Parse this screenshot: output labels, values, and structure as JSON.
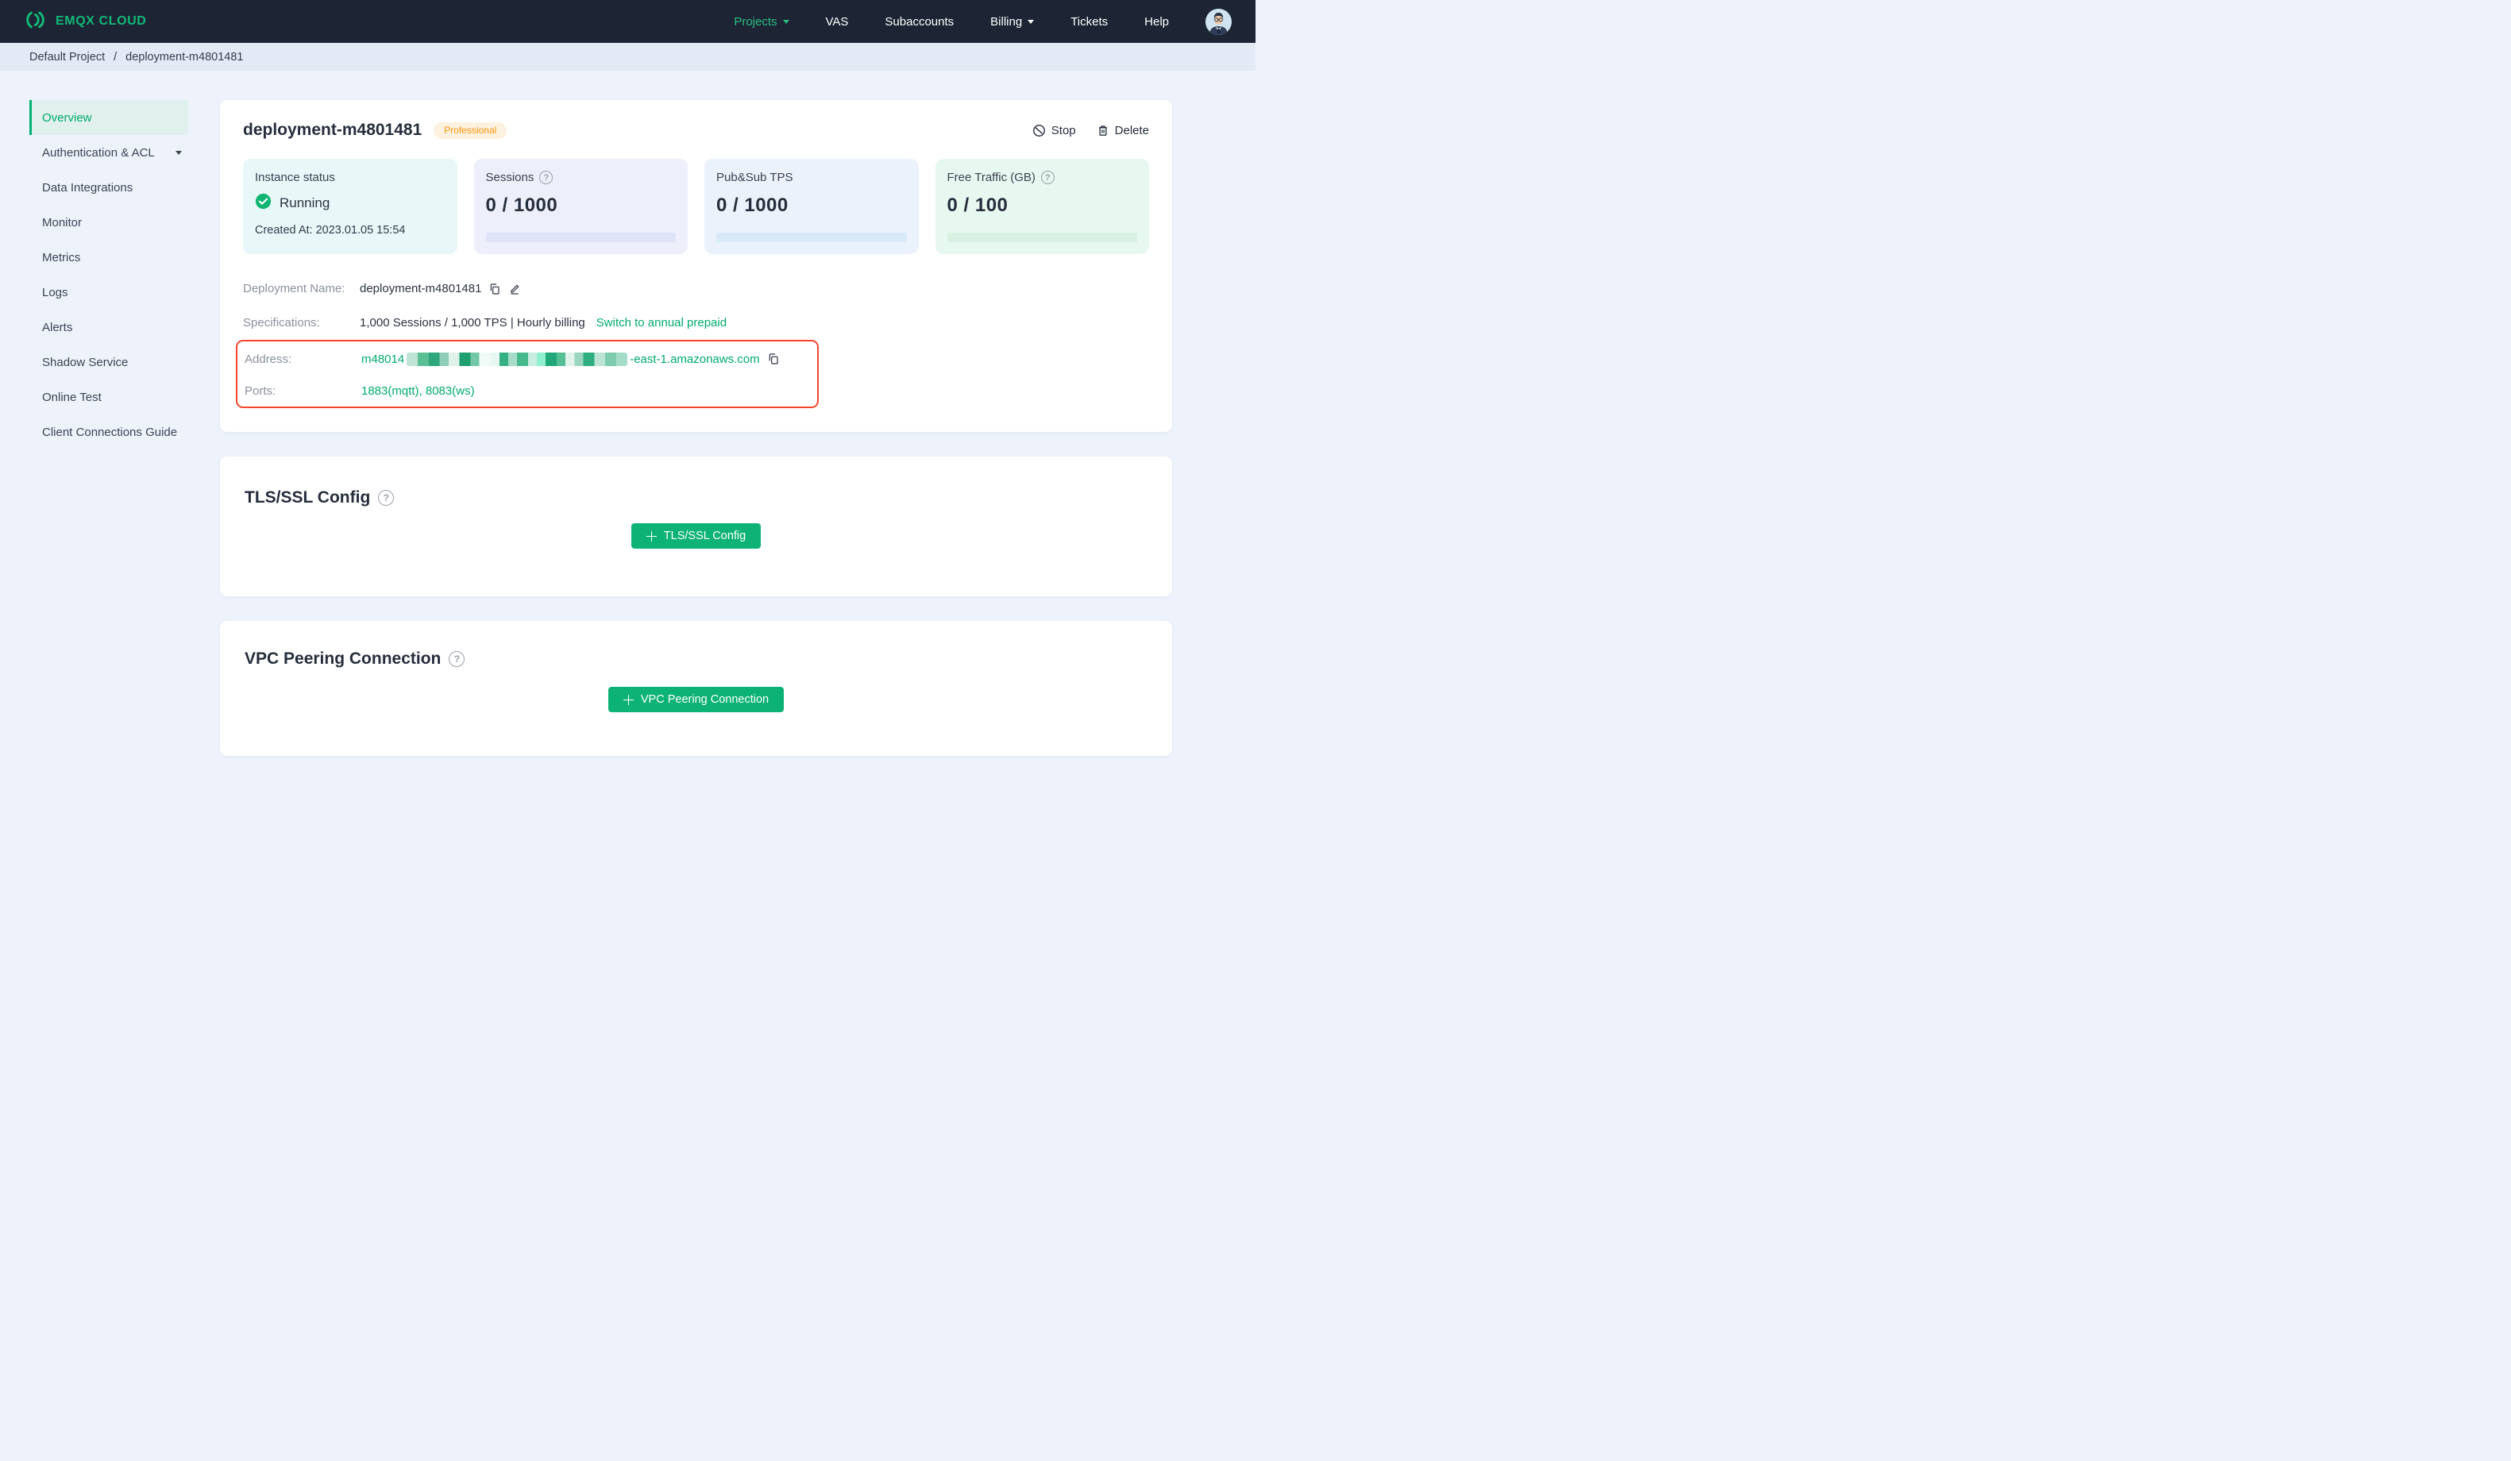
{
  "nav": {
    "brand": "EMQX CLOUD",
    "projects": "Projects",
    "vas": "VAS",
    "subaccounts": "Subaccounts",
    "billing": "Billing",
    "tickets": "Tickets",
    "help": "Help"
  },
  "breadcrumb": {
    "project": "Default Project",
    "separator": "/",
    "current": "deployment-m4801481"
  },
  "sidebar": {
    "items": [
      {
        "label": "Overview"
      },
      {
        "label": "Authentication & ACL"
      },
      {
        "label": "Data Integrations"
      },
      {
        "label": "Monitor"
      },
      {
        "label": "Metrics"
      },
      {
        "label": "Logs"
      },
      {
        "label": "Alerts"
      },
      {
        "label": "Shadow Service"
      },
      {
        "label": "Online Test"
      },
      {
        "label": "Client Connections Guide"
      }
    ]
  },
  "deployment": {
    "title": "deployment-m4801481",
    "badge": "Professional",
    "stop_label": "Stop",
    "delete_label": "Delete",
    "stats": {
      "instance": {
        "label": "Instance status",
        "status": "Running",
        "created": "Created At: 2023.01.05 15:54"
      },
      "sessions": {
        "label": "Sessions",
        "value": "0 / 1000",
        "help": "?"
      },
      "tps": {
        "label": "Pub&Sub TPS",
        "value": "0 / 1000"
      },
      "traffic": {
        "label": "Free Traffic (GB)",
        "value": "0 / 100",
        "help": "?"
      }
    },
    "details": {
      "name_label": "Deployment Name:",
      "name_value": "deployment-m4801481",
      "spec_label": "Specifications:",
      "spec_value": "1,000 Sessions / 1,000 TPS | Hourly billing",
      "spec_link": "Switch to annual prepaid",
      "address_label": "Address:",
      "address_prefix": "m48014",
      "address_suffix": "-east-1.amazonaws.com",
      "ports_label": "Ports:",
      "ports_value": "1883(mqtt), 8083(ws)"
    }
  },
  "tls": {
    "title": "TLS/SSL Config",
    "help": "?",
    "button": "TLS/SSL Config"
  },
  "vpc": {
    "title": "VPC Peering Connection",
    "help": "?",
    "button": "VPC Peering Connection"
  },
  "colors": {
    "navbar": "#1d2534",
    "accent_green": "#00ab6b",
    "button_green": "#0cb374",
    "brand_green": "#12b877",
    "badge_orange_text": "#f9960f",
    "badge_orange_bg": "#fdf1df",
    "highlight_red": "#f5452c",
    "status_check_green": "#10b573",
    "page_bg": "#edf2fb",
    "breadcrumb_bg": "#e4e9f6",
    "stat_instance_bg": "#e8f7f8",
    "stat_sessions_bg": "#edeffa",
    "stat_tps_bg": "#ecf2fb",
    "stat_traffic_bg": "#e7f8f0"
  }
}
